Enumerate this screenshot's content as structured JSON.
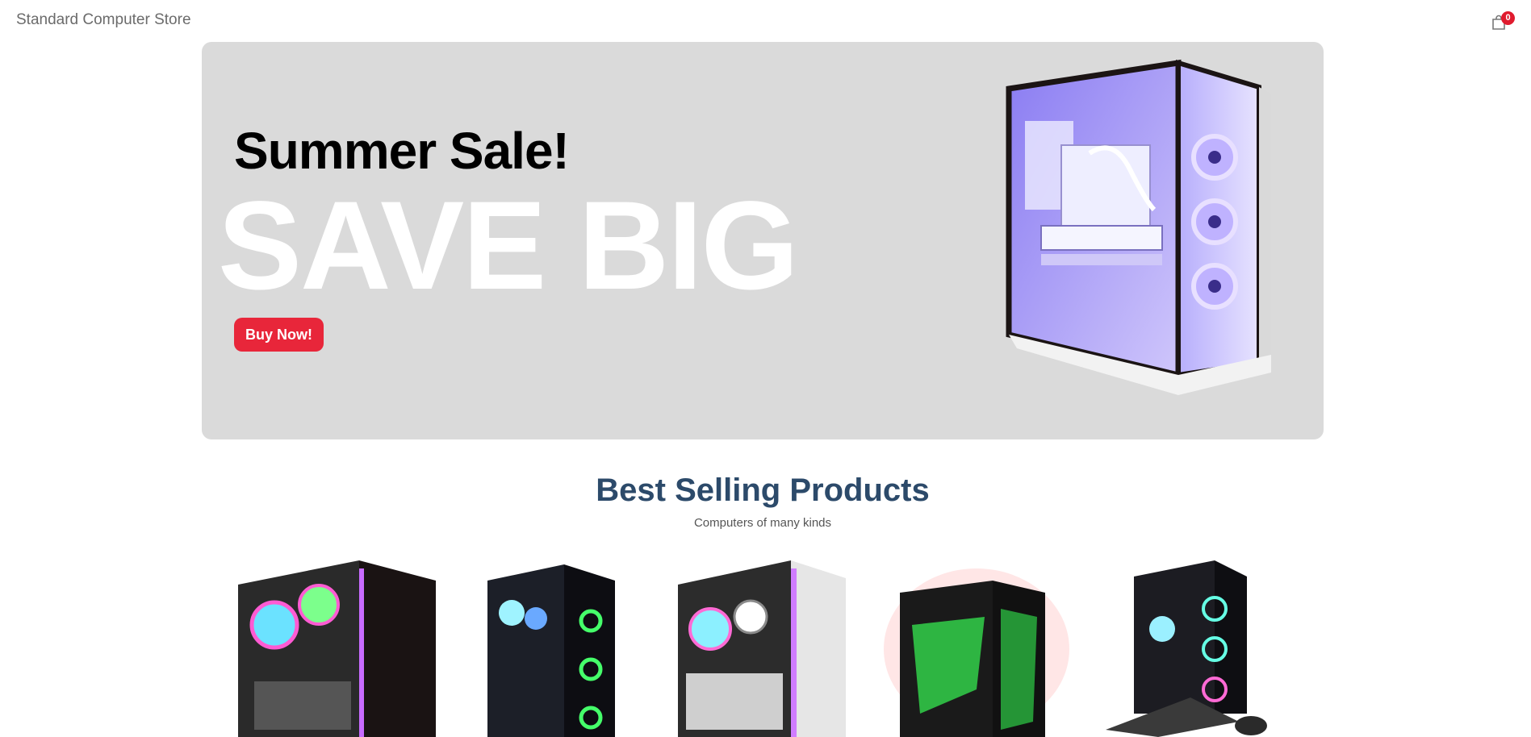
{
  "nav": {
    "brand": "Standard Computer Store",
    "cart_count": "0"
  },
  "hero": {
    "title": "Summer Sale!",
    "tagline": "SAVE BIG",
    "cta_label": "Buy Now!"
  },
  "products_section": {
    "title": "Best Selling Products",
    "subtitle": "Computers of many kinds"
  },
  "colors": {
    "brand_text": "#6b6b6b",
    "badge": "#e01b2e",
    "cta": "#e8263a",
    "hero_bg": "#dadada",
    "section_title": "#2c4a6a"
  },
  "icons": [
    "shopping-bag-icon"
  ]
}
